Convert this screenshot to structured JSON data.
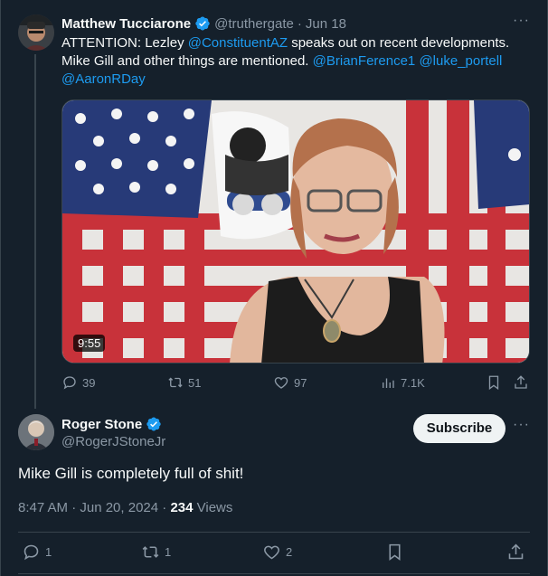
{
  "parent_tweet": {
    "author_name": "Matthew Tucciarone",
    "handle": "@truthergate",
    "date": "Jun 18",
    "separator": "·",
    "text_parts": {
      "p1": "ATTENTION: Lezley ",
      "m1": "@ConstituentAZ",
      "p2": " speaks out on recent developments. Mike Gill and other things are mentioned. ",
      "m2": "@BrianFerence1",
      "sp": " ",
      "m3": "@luke_portell",
      "m4": "@AaronRDay"
    },
    "video_duration": "9:55",
    "stats": {
      "replies": "39",
      "reposts": "51",
      "likes": "97",
      "views": "7.1K"
    }
  },
  "main_tweet": {
    "author_name": "Roger Stone",
    "handle": "@RogerJStoneJr",
    "subscribe_label": "Subscribe",
    "text": "Mike Gill is completely full of shit!",
    "time": "8:47 AM · Jun 20, 2024 · ",
    "views_count": "234",
    "views_label": " Views",
    "stats": {
      "replies": "1",
      "reposts": "1",
      "likes": "2"
    }
  },
  "colors": {
    "background": "#15202b",
    "link": "#1d9bf0",
    "muted": "#8b98a5",
    "verified": "#1d9bf0"
  }
}
